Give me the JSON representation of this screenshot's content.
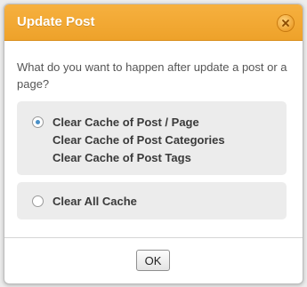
{
  "dialog": {
    "title": "Update Post",
    "prompt": "What do you want to happen after update a post or a page?",
    "options": [
      {
        "lines": [
          "Clear Cache of Post / Page",
          "Clear Cache of Post Categories",
          "Clear Cache of Post Tags"
        ],
        "selected": true
      },
      {
        "lines": [
          "Clear All Cache"
        ],
        "selected": false
      }
    ],
    "ok_label": "OK",
    "close_icon": "close-icon"
  },
  "colors": {
    "title_bar": "#f0a42c",
    "option_background": "#ececec",
    "radio_selected": "#4a90c8"
  }
}
